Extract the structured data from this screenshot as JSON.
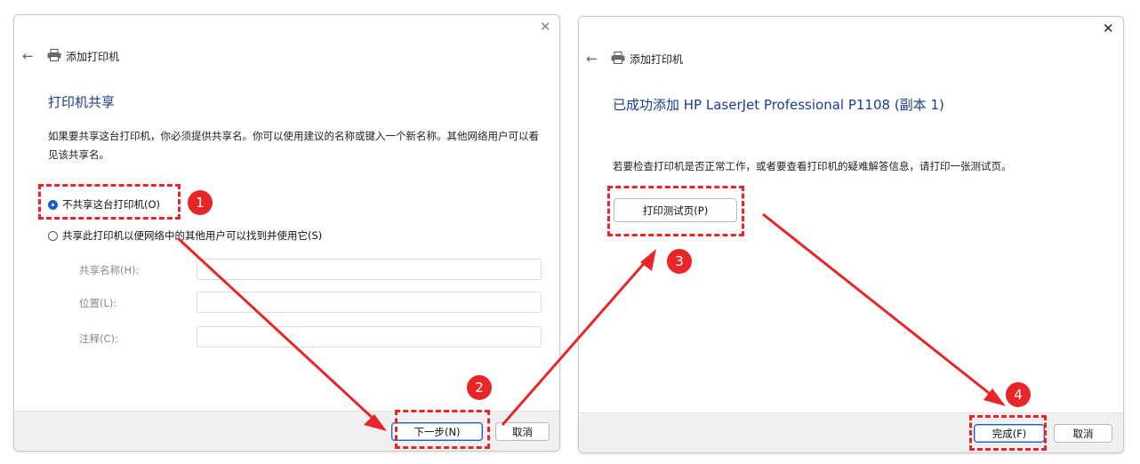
{
  "dialog1": {
    "title": "添加打印机",
    "heading": "打印机共享",
    "description": "如果要共享这台打印机，你必须提供共享名。你可以使用建议的名称或键入一个新名称。其他网络用户可以看见该共享名。",
    "radio_no_share": "不共享这台打印机(O)",
    "radio_share": "共享此打印机以便网络中的其他用户可以找到并使用它(S)",
    "share_name_label": "共享名称(H):",
    "location_label": "位置(L):",
    "comment_label": "注释(C):",
    "share_name_value": "",
    "location_value": "",
    "comment_value": "",
    "next_button": "下一步(N)",
    "cancel_button": "取消"
  },
  "dialog2": {
    "title": "添加打印机",
    "heading": "已成功添加 HP LaserJet Professional P1108 (副本 1)",
    "description": "若要检查打印机是否正常工作，或者要查看打印机的疑难解答信息，请打印一张测试页。",
    "print_test_button": "打印测试页(P)",
    "finish_button": "完成(F)",
    "cancel_button": "取消"
  },
  "annotations": {
    "step1": "1",
    "step2": "2",
    "step3": "3",
    "step4": "4",
    "color": "#e8262a"
  },
  "icons": {
    "back": "back-arrow-icon",
    "printer": "printer-icon",
    "close": "close-icon"
  }
}
